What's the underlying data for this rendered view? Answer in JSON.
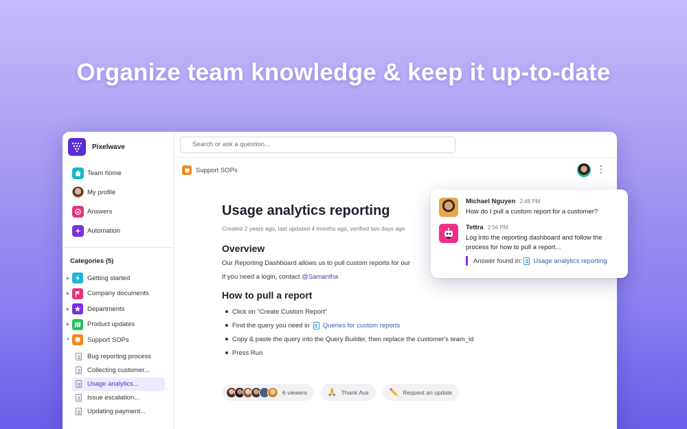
{
  "hero": {
    "headline": "Organize team knowledge & keep it up-to-date"
  },
  "workspace": {
    "name": "Pixelwave"
  },
  "nav": [
    {
      "label": "Team home",
      "icon": "home-icon",
      "color": "#14b8c7"
    },
    {
      "label": "My profile",
      "icon": "avatar"
    },
    {
      "label": "Answers",
      "icon": "checkmark-icon",
      "color": "#e8307b"
    },
    {
      "label": "Automation",
      "icon": "sparkle-icon",
      "color": "#7a2fe0"
    }
  ],
  "categories": {
    "title": "Categories (5)",
    "items": [
      {
        "label": "Getting started",
        "icon": "lightning-icon",
        "color": "#20b5d4",
        "expanded": false
      },
      {
        "label": "Company documents",
        "icon": "flag-icon",
        "color": "#ea2f7a",
        "expanded": false
      },
      {
        "label": "Departments",
        "icon": "star-icon",
        "color": "#7b2fe0",
        "expanded": false
      },
      {
        "label": "Product updates",
        "icon": "map-icon",
        "color": "#25c05a",
        "expanded": false
      },
      {
        "label": "Support SOPs",
        "icon": "cart-icon",
        "color": "#f08a1c",
        "expanded": true
      }
    ],
    "sub_items": [
      {
        "label": "Bug reporting process",
        "active": false
      },
      {
        "label": "Collecting customer...",
        "active": false
      },
      {
        "label": "Usage analytics...",
        "active": true
      },
      {
        "label": "Issue escalation...",
        "active": false
      },
      {
        "label": "Updating payment...",
        "active": false
      }
    ]
  },
  "search": {
    "placeholder": "Search or ask a question..."
  },
  "breadcrumb": {
    "label": "Support SOPs"
  },
  "document": {
    "title": "Usage analytics reporting",
    "meta": "Created 2 years ago, last updated 4 months ago, verified two days ago",
    "overview_heading": "Overview",
    "overview_text": "Our Reporting Dashboard allows us to pull custom reports for our",
    "login_text": "If you need a login, contact",
    "login_mention": "@Samantha",
    "howto_heading": "How to pull a report",
    "steps": {
      "step1": "Click on \"Create Custom Report\"",
      "step2_prefix": "Find the query you need in",
      "step2_link": "Queries for custom reports",
      "step3": "Copy & paste the query into the Query Builder, then replace the customer's team_id",
      "step4": "Press Run"
    }
  },
  "footer": {
    "viewers_label": "6 viewers",
    "thanks_label": "Thank Ava",
    "thanks_emoji": "🙏",
    "update_label": "Request an update",
    "update_emoji": "✏️"
  },
  "chat": {
    "messages": [
      {
        "name": "Michael Nguyen",
        "time": "2:48 PM",
        "text": "How do I pull a custom report for a customer?"
      },
      {
        "name": "Tettra",
        "time": "2:56 PM",
        "text": "Log into the reporting dashboard and follow the process for how to pull a report..."
      }
    ],
    "answer_prefix": "Answer found in:",
    "answer_link": "Usage analytics reporting"
  },
  "colors": {
    "brand": "#5b2bd6",
    "accent": "#7b2fe0",
    "link": "#2f5fa8"
  }
}
